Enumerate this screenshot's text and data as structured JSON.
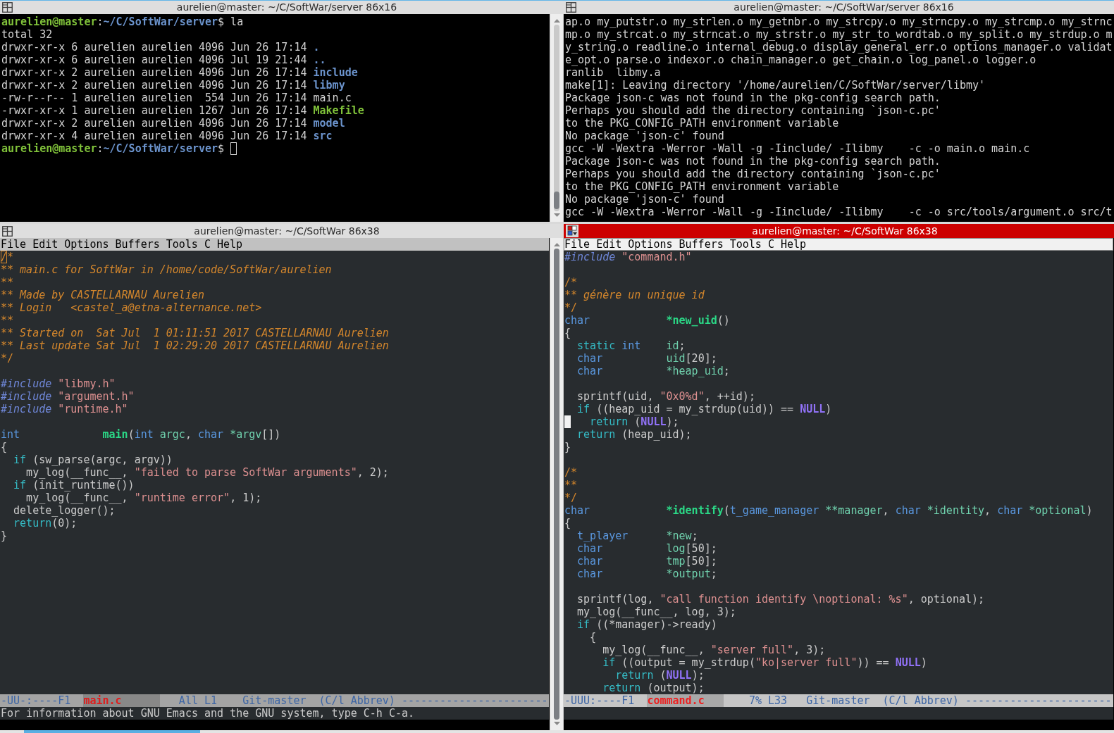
{
  "windows": [
    {
      "kind": "terminal",
      "title": "aurelien@master: ~/C/SoftWar/server 86x16",
      "focused": false,
      "lines": [
        [
          {
            "kind": "user",
            "text": "aurelien@master"
          },
          ":",
          {
            "kind": "dir",
            "text": "~/C/SoftWar/server"
          },
          "$ la"
        ],
        "total 32",
        [
          "drwxr-xr-x 6 aurelien aurelien 4096 Jun 26 17:14 ",
          {
            "kind": "dir",
            "text": "."
          }
        ],
        [
          "drwxr-xr-x 6 aurelien aurelien 4096 Jul 19 21:44 ",
          {
            "kind": "dir",
            "text": ".."
          }
        ],
        [
          "drwxr-xr-x 2 aurelien aurelien 4096 Jun 26 17:14 ",
          {
            "kind": "dir",
            "text": "include"
          }
        ],
        [
          "drwxr-xr-x 2 aurelien aurelien 4096 Jun 26 17:14 ",
          {
            "kind": "dir",
            "text": "libmy"
          }
        ],
        "-rw-r--r-- 1 aurelien aurelien  554 Jun 26 17:14 main.c",
        [
          "-rwxr-xr-x 1 aurelien aurelien 1267 Jun 26 17:14 ",
          {
            "kind": "exec",
            "text": "Makefile"
          }
        ],
        [
          "drwxr-xr-x 2 aurelien aurelien 4096 Jun 26 17:14 ",
          {
            "kind": "dir",
            "text": "model"
          }
        ],
        [
          "drwxr-xr-x 4 aurelien aurelien 4096 Jun 26 17:14 ",
          {
            "kind": "dir",
            "text": "src"
          }
        ],
        [
          {
            "kind": "user",
            "text": "aurelien@master"
          },
          ":",
          {
            "kind": "dir",
            "text": "~/C/SoftWar/server"
          },
          "$ ",
          {
            "kind": "cursor"
          }
        ]
      ]
    },
    {
      "kind": "terminal",
      "title": "aurelien@master: ~/C/SoftWar/server 86x16",
      "focused": false,
      "lines": [
        "ap.o my_putstr.o my_strlen.o my_getnbr.o my_strcpy.o my_strncpy.o my_strcmp.o my_strnc",
        "mp.o my_strcat.o my_strncat.o my_strstr.o my_str_to_wordtab.o my_split.o my_strdup.o m",
        "y_string.o readline.o internal_debug.o display_general_err.o options_manager.o validat",
        "e_opt.o parse.o indexor.o chain_manager.o get_chain.o log_panel.o logger.o",
        "ranlib  libmy.a",
        "make[1]: Leaving directory '/home/aurelien/C/SoftWar/server/libmy'",
        "Package json-c was not found in the pkg-config search path.",
        "Perhaps you should add the directory containing `json-c.pc'",
        "to the PKG_CONFIG_PATH environment variable",
        "No package 'json-c' found",
        "gcc -W -Wextra -Werror -Wall -g -Iinclude/ -Ilibmy    -c -o main.o main.c",
        "Package json-c was not found in the pkg-config search path.",
        "Perhaps you should add the directory containing `json-c.pc'",
        "to the PKG_CONFIG_PATH environment variable",
        "No package 'json-c' found",
        "gcc -W -Wextra -Werror -Wall -g -Iinclude/ -Ilibmy    -c -o src/tools/argument.o src/t"
      ]
    },
    {
      "kind": "editor",
      "title": "aurelien@master: ~/C/SoftWar 86x38",
      "focused": false,
      "menu": [
        "File",
        "Edit",
        "Options",
        "Buffers",
        "Tools",
        "C",
        "Help"
      ],
      "blocks": [
        {
          "lines": [
            [
              {
                "kind": "cursor",
                "text": "/"
              },
              {
                "kind": "comment-delimiter",
                "text": "*"
              }
            ],
            [
              {
                "kind": "comment-delimiter",
                "text": "** "
              },
              {
                "kind": "comment",
                "text": "main.c for SoftWar in /home/code/SoftWar/aurelien"
              }
            ],
            [
              {
                "kind": "comment-delimiter",
                "text": "**"
              }
            ],
            [
              {
                "kind": "comment-delimiter",
                "text": "** "
              },
              {
                "kind": "comment",
                "text": "Made by CASTELLARNAU Aurelien"
              }
            ],
            [
              {
                "kind": "comment-delimiter",
                "text": "** "
              },
              {
                "kind": "comment",
                "text": "Login   <castel_a@etna-alternance.net>"
              }
            ],
            [
              {
                "kind": "comment-delimiter",
                "text": "**"
              }
            ],
            [
              {
                "kind": "comment-delimiter",
                "text": "** "
              },
              {
                "kind": "comment",
                "text": "Started on  Sat Jul  1 01:11:51 2017 CASTELLARNAU Aurelien"
              }
            ],
            [
              {
                "kind": "comment-delimiter",
                "text": "** "
              },
              {
                "kind": "comment",
                "text": "Last update Sat Jul  1 02:29:20 2017 CASTELLARNAU Aurelien"
              }
            ],
            [
              {
                "kind": "comment-delimiter",
                "text": "*/"
              }
            ]
          ]
        },
        {
          "lines": [
            [
              {
                "kind": "preproc",
                "text": "#include "
              },
              {
                "kind": "string",
                "text": "\"libmy.h\""
              }
            ],
            [
              {
                "kind": "preproc",
                "text": "#include "
              },
              {
                "kind": "string",
                "text": "\"argument.h\""
              }
            ],
            [
              {
                "kind": "preproc",
                "text": "#include "
              },
              {
                "kind": "string",
                "text": "\"runtime.h\""
              }
            ]
          ]
        },
        {
          "lines": [
            [
              {
                "kind": "type",
                "text": "int             "
              },
              {
                "kind": "function",
                "text": "main"
              },
              "(",
              {
                "kind": "type",
                "text": "int "
              },
              {
                "kind": "variable",
                "text": "argc"
              },
              ", ",
              {
                "kind": "type",
                "text": "char "
              },
              {
                "kind": "variable",
                "text": "*argv"
              },
              "[])"
            ],
            "{",
            [
              {
                "kind": "keyword",
                "text": "  if"
              },
              " (sw_parse(argc, argv))"
            ],
            [
              "    my_log(__func__, ",
              {
                "kind": "string",
                "text": "\"failed to parse SoftWar arguments\""
              },
              ", 2);"
            ],
            [
              {
                "kind": "keyword",
                "text": "  if"
              },
              " (init_runtime())"
            ],
            [
              "    my_log(__func__, ",
              {
                "kind": "string",
                "text": "\"runtime error\""
              },
              ", 1);"
            ],
            "  delete_logger();",
            [
              {
                "kind": "keyword",
                "text": "  return"
              },
              "(0);"
            ],
            "}"
          ]
        }
      ],
      "mode_line": [
        "-UU-:----F1  ",
        {
          "kind": "buffer",
          "text": "main.c"
        },
        "   All L1    Git-master  (C/l Abbrev) -----------------------"
      ],
      "echo_area": "For information about GNU Emacs and the GNU system, type C-h C-a."
    },
    {
      "kind": "editor",
      "title": "aurelien@master: ~/C/SoftWar 86x38",
      "focused": true,
      "menu": [
        "File",
        "Edit",
        "Options",
        "Buffers",
        "Tools",
        "C",
        "Help"
      ],
      "blocks": [
        {
          "lines": [
            [
              {
                "kind": "preproc",
                "text": "#include "
              },
              {
                "kind": "string",
                "text": "\"command.h\""
              }
            ]
          ]
        },
        {
          "lines": [
            [
              {
                "kind": "comment-delimiter",
                "text": "/*"
              }
            ],
            [
              {
                "kind": "comment-delimiter",
                "text": "** "
              },
              {
                "kind": "comment",
                "text": "génère un unique id"
              }
            ],
            [
              {
                "kind": "comment-delimiter",
                "text": "*/"
              }
            ],
            [
              {
                "kind": "type",
                "text": "char            "
              },
              {
                "kind": "function",
                "text": "*new_uid"
              },
              "()"
            ],
            "{",
            [
              {
                "kind": "keyword",
                "text": "  static "
              },
              {
                "kind": "type",
                "text": "int    "
              },
              {
                "kind": "variable",
                "text": "id"
              },
              ";"
            ],
            [
              {
                "kind": "type",
                "text": "  char          "
              },
              {
                "kind": "variable",
                "text": "uid"
              },
              "[20];"
            ],
            [
              {
                "kind": "type",
                "text": "  char          "
              },
              {
                "kind": "variable",
                "text": "*heap_uid"
              },
              ";"
            ]
          ]
        },
        {
          "lines": [
            [
              "  sprintf(uid, ",
              {
                "kind": "string",
                "text": "\"0x0%d\""
              },
              ", ++id);"
            ],
            [
              {
                "kind": "keyword",
                "text": "  if"
              },
              " ((heap_uid = my_strdup(uid)) == ",
              {
                "kind": "constant",
                "text": "NULL"
              },
              ")"
            ],
            [
              {
                "kind": "cursor"
              },
              {
                "kind": "keyword",
                "text": "   return"
              },
              " (",
              {
                "kind": "constant",
                "text": "NULL"
              },
              ");"
            ],
            [
              {
                "kind": "keyword",
                "text": "  return"
              },
              " (heap_uid);"
            ],
            "}"
          ]
        },
        {
          "lines": [
            [
              {
                "kind": "comment-delimiter",
                "text": "/*"
              }
            ],
            [
              {
                "kind": "comment-delimiter",
                "text": "**"
              }
            ],
            [
              {
                "kind": "comment-delimiter",
                "text": "*/"
              }
            ],
            [
              {
                "kind": "type",
                "text": "char            "
              },
              {
                "kind": "function",
                "text": "*identify"
              },
              "(",
              {
                "kind": "type",
                "text": "t_game_manager "
              },
              {
                "kind": "variable",
                "text": "**manager"
              },
              ", ",
              {
                "kind": "type",
                "text": "char "
              },
              {
                "kind": "variable",
                "text": "*identity"
              },
              ", ",
              {
                "kind": "type",
                "text": "char "
              },
              {
                "kind": "variable",
                "text": "*optional"
              },
              ")"
            ],
            "{",
            [
              {
                "kind": "type",
                "text": "  t_player      "
              },
              {
                "kind": "variable",
                "text": "*new"
              },
              ";"
            ],
            [
              {
                "kind": "type",
                "text": "  char          "
              },
              {
                "kind": "variable",
                "text": "log"
              },
              "[50];"
            ],
            [
              {
                "kind": "type",
                "text": "  char          "
              },
              {
                "kind": "variable",
                "text": "tmp"
              },
              "[50];"
            ],
            [
              {
                "kind": "type",
                "text": "  char          "
              },
              {
                "kind": "variable",
                "text": "*output"
              },
              ";"
            ]
          ]
        },
        {
          "lines": [
            [
              "  sprintf(log, ",
              {
                "kind": "string",
                "text": "\"call function identify \\noptional: %s\""
              },
              ", optional);"
            ],
            "  my_log(__func__, log, 3);",
            [
              {
                "kind": "keyword",
                "text": "  if"
              },
              " ((*manager)->ready)"
            ],
            "    {",
            [
              "      my_log(__func__, ",
              {
                "kind": "string",
                "text": "\"server full\""
              },
              ", 3);"
            ],
            [
              {
                "kind": "keyword",
                "text": "      if"
              },
              " ((output = my_strdup(",
              {
                "kind": "string",
                "text": "\"ko|server full\""
              },
              ")) == ",
              {
                "kind": "constant",
                "text": "NULL"
              },
              ")"
            ],
            [
              {
                "kind": "keyword",
                "text": "        return"
              },
              " (",
              {
                "kind": "constant",
                "text": "NULL"
              },
              ");"
            ],
            [
              {
                "kind": "keyword",
                "text": "      return"
              },
              " (output);"
            ]
          ]
        }
      ],
      "mode_line": [
        "-UUU:----F1  ",
        {
          "kind": "buffer",
          "text": "command.c"
        },
        "    7% L33   Git-master  (C/l Abbrev) -----------------------"
      ]
    }
  ]
}
